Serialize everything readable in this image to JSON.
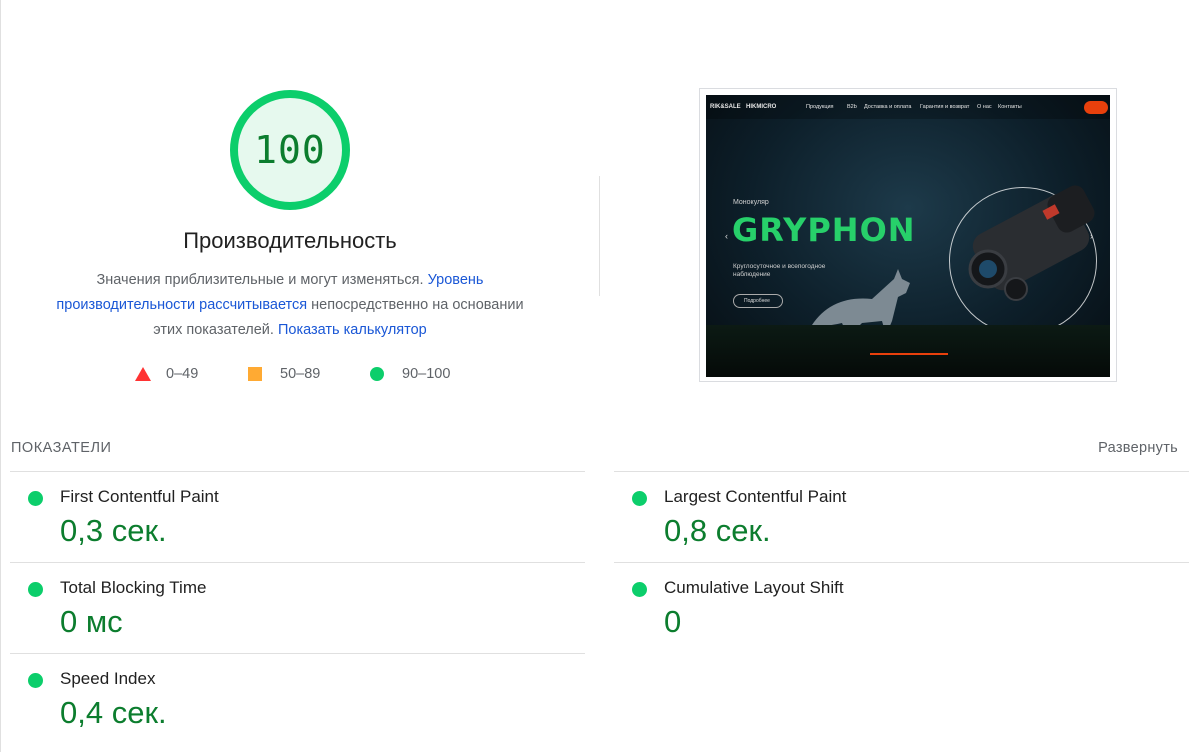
{
  "summary": {
    "score": "100",
    "title": "Производительность",
    "desc_text_1": "Значения приблизительные и могут изменяться.",
    "desc_link_1": "Уровень производительности рассчитывается",
    "desc_text_2": "непосредственно на основании этих показателей.",
    "desc_link_2": "Показать калькулятор",
    "score_fraction": 1.0
  },
  "legend": [
    {
      "label": "0–49",
      "color": "#ff3333",
      "icon": "triangle-icon"
    },
    {
      "label": "50–89",
      "color": "#ffaa33",
      "icon": "square-icon"
    },
    {
      "label": "90–100",
      "color": "#0cce6b",
      "icon": "circle-icon"
    }
  ],
  "thumbnail": {
    "logo": "RIK&SALE",
    "brand": "HIKMICRO",
    "nav": [
      "Продукция",
      "B2b",
      "Доставка и оплата",
      "Гарантия и возврат",
      "О нас",
      "Контакты"
    ],
    "subtitle": "Монокуляр",
    "title": "GRYPHON",
    "description": "Круглосуточное и всепогодное наблюдение",
    "button": "Подробнее"
  },
  "metrics": {
    "header": "ПОКАЗАТЕЛИ",
    "expand": "Развернуть",
    "items": [
      {
        "name": "First Contentful Paint",
        "value": "0,3 сек.",
        "status_color": "#0cce6b"
      },
      {
        "name": "Largest Contentful Paint",
        "value": "0,8 сек.",
        "status_color": "#0cce6b"
      },
      {
        "name": "Total Blocking Time",
        "value": "0 мс",
        "status_color": "#0cce6b"
      },
      {
        "name": "Cumulative Layout Shift",
        "value": "0",
        "status_color": "#0cce6b"
      },
      {
        "name": "Speed Index",
        "value": "0,4 сек.",
        "status_color": "#0cce6b"
      }
    ]
  },
  "colors": {
    "pass": "#0cce6b",
    "pass_text": "#0c7d2e",
    "link": "#1a57d6",
    "average": "#ffaa33",
    "fail": "#ff3333"
  }
}
